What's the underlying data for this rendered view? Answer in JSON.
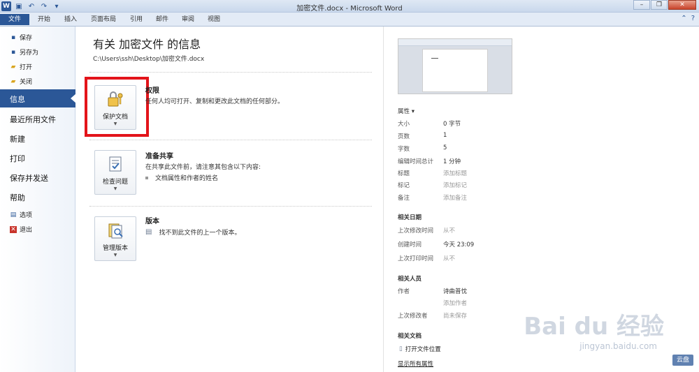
{
  "window": {
    "title": "加密文件.docx - Microsoft Word"
  },
  "ribbon": {
    "tabs": [
      "文件",
      "开始",
      "插入",
      "页面布局",
      "引用",
      "邮件",
      "审阅",
      "视图"
    ]
  },
  "nav": {
    "save": "保存",
    "save_as": "另存为",
    "open": "打开",
    "close": "关闭",
    "info": "信息",
    "recent": "最近所用文件",
    "new": "新建",
    "print": "打印",
    "save_send": "保存并发送",
    "help": "帮助",
    "options": "选项",
    "exit": "退出"
  },
  "main": {
    "title": "有关 加密文件 的信息",
    "path": "C:\\Users\\ssh\\Desktop\\加密文件.docx",
    "permissions": {
      "button": "保护文档",
      "heading": "权限",
      "text": "任何人均可打开、复制和更改此文档的任何部分。"
    },
    "prepare": {
      "button": "检查问题",
      "heading": "准备共享",
      "text": "在共享此文件前，请注意其包含以下内容:",
      "bullet": "文档属性和作者的姓名"
    },
    "versions": {
      "button": "管理版本",
      "heading": "版本",
      "text": "找不到此文件的上一个版本。"
    }
  },
  "properties": {
    "header": "属性",
    "rows": [
      {
        "label": "大小",
        "value": "0 字节"
      },
      {
        "label": "页数",
        "value": "1"
      },
      {
        "label": "字数",
        "value": "5"
      },
      {
        "label": "编辑时间总计",
        "value": "1 分钟"
      },
      {
        "label": "标题",
        "value": "添加标题"
      },
      {
        "label": "标记",
        "value": "添加标记"
      },
      {
        "label": "备注",
        "value": "添加备注"
      }
    ],
    "dates_header": "相关日期",
    "dates": [
      {
        "label": "上次修改时间",
        "value": "从不"
      },
      {
        "label": "创建时间",
        "value": "今天 23:09"
      },
      {
        "label": "上次打印时间",
        "value": "从不"
      }
    ],
    "people_header": "相关人员",
    "author_label": "作者",
    "author_value": "诗曲普忱",
    "add_author": "添加作者",
    "last_modified_by_label": "上次修改者",
    "last_modified_by_value": "尚未保存",
    "docs_header": "相关文档",
    "open_location": "打开文件位置",
    "show_all": "显示所有属性"
  },
  "watermark": {
    "text": "Bai du 经验",
    "url": "jingyan.baidu.com",
    "badge": "云盘"
  }
}
